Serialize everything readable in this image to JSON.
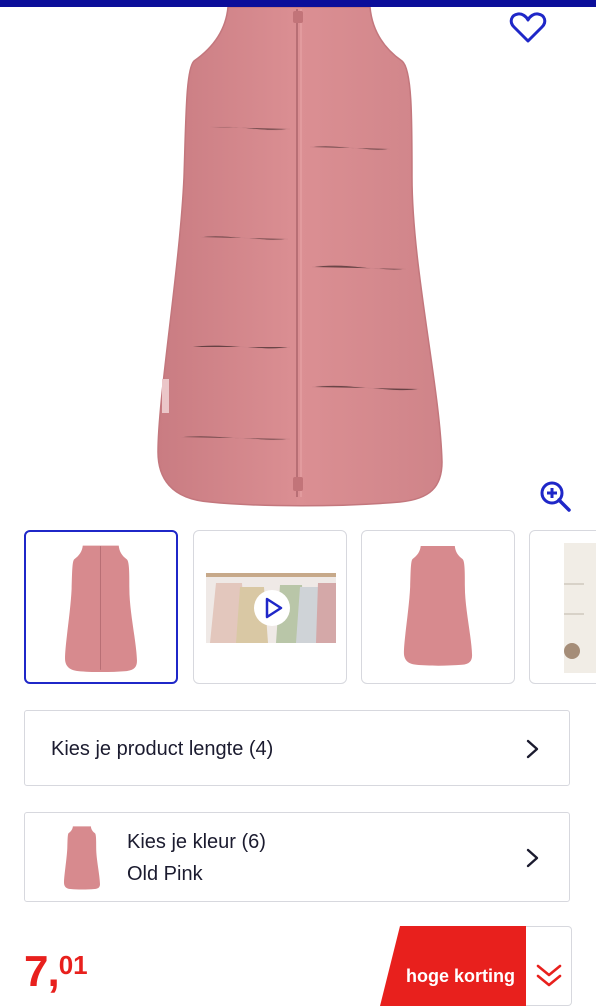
{
  "product": {
    "image_alt": "Old Pink slaapzak",
    "zoom_icon": "zoom-in-icon",
    "favorite_icon": "heart-icon"
  },
  "gallery": {
    "thumbs": [
      {
        "kind": "image",
        "icon": "sleeping-bag-image",
        "selected": true
      },
      {
        "kind": "video",
        "icon": "play-icon",
        "selected": false
      },
      {
        "kind": "image",
        "icon": "sleeping-bag-image",
        "selected": false
      },
      {
        "kind": "image",
        "icon": "room-image",
        "selected": false
      }
    ]
  },
  "options": {
    "length": {
      "label": "Kies je product lengte (4)",
      "icon": "chevron-right-icon"
    },
    "color": {
      "label": "Kies je kleur (6)",
      "value": "Old Pink",
      "icon": "chevron-right-icon"
    }
  },
  "price": {
    "integer": "7,",
    "decimals": "01"
  },
  "promo": {
    "label": "hoge korting",
    "icon": "double-chevron-down-icon"
  },
  "colors": {
    "brand_blue": "#0b0e9a",
    "accent_blue": "#1f27c8",
    "price_red": "#e8201d",
    "product_pink": "#d78a8e"
  }
}
